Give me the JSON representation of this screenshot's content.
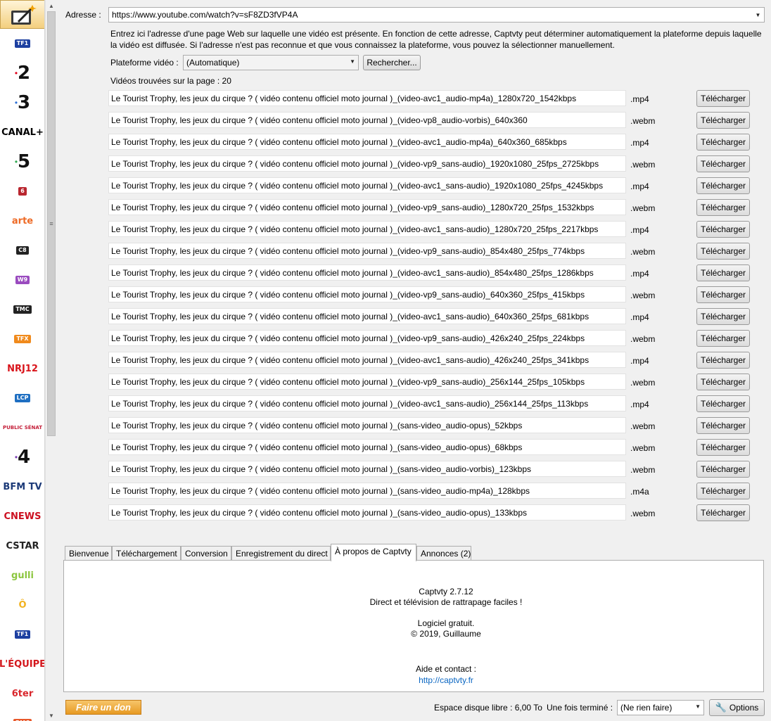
{
  "sidebar": {
    "channels": [
      {
        "name": "TF1",
        "color": "#1c3fa0"
      },
      {
        "name": "2",
        "color": "#e1001a"
      },
      {
        "name": "3",
        "color": "#2b6fd6"
      },
      {
        "name": "CANAL+",
        "color": "#000000"
      },
      {
        "name": "5",
        "color": "#2fa84f"
      },
      {
        "name": "6",
        "color": "#b9262f"
      },
      {
        "name": "arte",
        "color": "#ee6a25"
      },
      {
        "name": "C8",
        "color": "#222222"
      },
      {
        "name": "W9",
        "color": "#9a4bbf"
      },
      {
        "name": "TMC",
        "color": "#222222"
      },
      {
        "name": "TFX",
        "color": "#f08a1c"
      },
      {
        "name": "NRJ12",
        "color": "#d9141b"
      },
      {
        "name": "LCP",
        "color": "#1f6fc2"
      },
      {
        "name": "PUBLIC SÉNAT",
        "color": "#c4203a"
      },
      {
        "name": "4",
        "color": "#7b3fb5"
      },
      {
        "name": "BFM TV",
        "color": "#1c3a78"
      },
      {
        "name": "CNEWS",
        "color": "#cc1020"
      },
      {
        "name": "CSTAR",
        "color": "#222222"
      },
      {
        "name": "gulli",
        "color": "#8cc63f"
      },
      {
        "name": "Ô",
        "color": "#f2b21f"
      },
      {
        "name": "TF1",
        "color": "#1c3fa0"
      },
      {
        "name": "L'ÉQUIPE",
        "color": "#d4171d"
      },
      {
        "name": "6ter",
        "color": "#d9262c"
      },
      {
        "name": "RMC",
        "color": "#e8582a"
      }
    ]
  },
  "address": {
    "label": "Adresse :",
    "value": "https://www.youtube.com/watch?v=sF8ZD3fVP4A",
    "description": "Entrez ici l'adresse d'une page Web sur laquelle une vidéo est présente. En fonction de cette adresse, Captvty peut déterminer automatiquement la plateforme depuis laquelle la vidéo est diffusée. Si l'adresse n'est pas reconnue et que vous connaissez la plateforme, vous pouvez la sélectionner manuellement."
  },
  "platform": {
    "label": "Plateforme vidéo :",
    "value": "(Automatique)",
    "search_label": "Rechercher..."
  },
  "results": {
    "count_label": "Vidéos trouvées sur la page : 20",
    "download_label": "Télécharger",
    "items": [
      {
        "name": "Le Tourist Trophy, les jeux du cirque ? ( vidéo contenu officiel moto journal )_(video-avc1_audio-mp4a)_1280x720_1542kbps",
        "ext": ".mp4"
      },
      {
        "name": "Le Tourist Trophy, les jeux du cirque ? ( vidéo contenu officiel moto journal )_(video-vp8_audio-vorbis)_640x360",
        "ext": ".webm"
      },
      {
        "name": "Le Tourist Trophy, les jeux du cirque ? ( vidéo contenu officiel moto journal )_(video-avc1_audio-mp4a)_640x360_685kbps",
        "ext": ".mp4"
      },
      {
        "name": "Le Tourist Trophy, les jeux du cirque ? ( vidéo contenu officiel moto journal )_(video-vp9_sans-audio)_1920x1080_25fps_2725kbps",
        "ext": ".webm"
      },
      {
        "name": "Le Tourist Trophy, les jeux du cirque ? ( vidéo contenu officiel moto journal )_(video-avc1_sans-audio)_1920x1080_25fps_4245kbps",
        "ext": ".mp4"
      },
      {
        "name": "Le Tourist Trophy, les jeux du cirque ? ( vidéo contenu officiel moto journal )_(video-vp9_sans-audio)_1280x720_25fps_1532kbps",
        "ext": ".webm"
      },
      {
        "name": "Le Tourist Trophy, les jeux du cirque ? ( vidéo contenu officiel moto journal )_(video-avc1_sans-audio)_1280x720_25fps_2217kbps",
        "ext": ".mp4"
      },
      {
        "name": "Le Tourist Trophy, les jeux du cirque ? ( vidéo contenu officiel moto journal )_(video-vp9_sans-audio)_854x480_25fps_774kbps",
        "ext": ".webm"
      },
      {
        "name": "Le Tourist Trophy, les jeux du cirque ? ( vidéo contenu officiel moto journal )_(video-avc1_sans-audio)_854x480_25fps_1286kbps",
        "ext": ".mp4"
      },
      {
        "name": "Le Tourist Trophy, les jeux du cirque ? ( vidéo contenu officiel moto journal )_(video-vp9_sans-audio)_640x360_25fps_415kbps",
        "ext": ".webm"
      },
      {
        "name": "Le Tourist Trophy, les jeux du cirque ? ( vidéo contenu officiel moto journal )_(video-avc1_sans-audio)_640x360_25fps_681kbps",
        "ext": ".mp4"
      },
      {
        "name": "Le Tourist Trophy, les jeux du cirque ? ( vidéo contenu officiel moto journal )_(video-vp9_sans-audio)_426x240_25fps_224kbps",
        "ext": ".webm"
      },
      {
        "name": "Le Tourist Trophy, les jeux du cirque ? ( vidéo contenu officiel moto journal )_(video-avc1_sans-audio)_426x240_25fps_341kbps",
        "ext": ".mp4"
      },
      {
        "name": "Le Tourist Trophy, les jeux du cirque ? ( vidéo contenu officiel moto journal )_(video-vp9_sans-audio)_256x144_25fps_105kbps",
        "ext": ".webm"
      },
      {
        "name": "Le Tourist Trophy, les jeux du cirque ? ( vidéo contenu officiel moto journal )_(video-avc1_sans-audio)_256x144_25fps_113kbps",
        "ext": ".mp4"
      },
      {
        "name": "Le Tourist Trophy, les jeux du cirque ? ( vidéo contenu officiel moto journal )_(sans-video_audio-opus)_52kbps",
        "ext": ".webm"
      },
      {
        "name": "Le Tourist Trophy, les jeux du cirque ? ( vidéo contenu officiel moto journal )_(sans-video_audio-opus)_68kbps",
        "ext": ".webm"
      },
      {
        "name": "Le Tourist Trophy, les jeux du cirque ? ( vidéo contenu officiel moto journal )_(sans-video_audio-vorbis)_123kbps",
        "ext": ".webm"
      },
      {
        "name": "Le Tourist Trophy, les jeux du cirque ? ( vidéo contenu officiel moto journal )_(sans-video_audio-mp4a)_128kbps",
        "ext": ".m4a"
      },
      {
        "name": "Le Tourist Trophy, les jeux du cirque ? ( vidéo contenu officiel moto journal )_(sans-video_audio-opus)_133kbps",
        "ext": ".webm"
      }
    ]
  },
  "tabs": [
    {
      "label": "Bienvenue",
      "active": false
    },
    {
      "label": "Téléchargement",
      "active": false
    },
    {
      "label": "Conversion",
      "active": false
    },
    {
      "label": "Enregistrement du direct",
      "active": false
    },
    {
      "label": "À propos de Captvty",
      "active": true
    },
    {
      "label": "Annonces (2)",
      "active": false
    }
  ],
  "about": {
    "version": "Captvty 2.7.12",
    "tagline": "Direct et télévision de rattrapage faciles !",
    "license": "Logiciel gratuit.",
    "copyright": "© 2019, Guillaume",
    "contact_label": "Aide et contact :",
    "link": "http://captvty.fr"
  },
  "footer": {
    "donate_label": "Faire un don",
    "disk_label": "Espace disque libre : 6,00 To",
    "when_done_label": "Une fois terminé :",
    "when_done_value": "(Ne rien faire)",
    "options_label": "Options"
  }
}
